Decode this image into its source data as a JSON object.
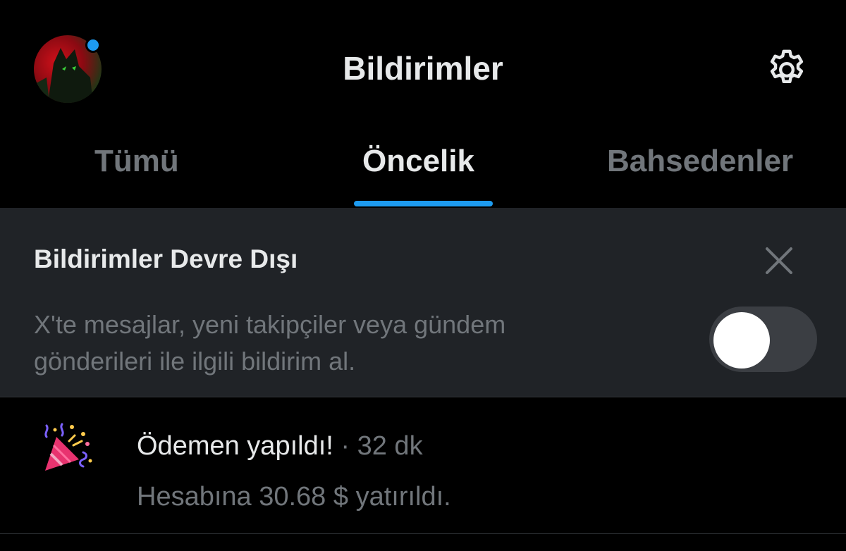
{
  "header": {
    "title": "Bildirimler",
    "avatar_icon": "wolf-avatar",
    "settings_icon": "gear-icon"
  },
  "tabs": [
    {
      "label": "Tümü",
      "active": false
    },
    {
      "label": "Öncelik",
      "active": true
    },
    {
      "label": "Bahsedenler",
      "active": false
    }
  ],
  "banner": {
    "title": "Bildirimler Devre Dışı",
    "description_line1": "X'te mesajlar, yeni takipçiler veya gündem",
    "description_line2": "gönderileri ile ilgili bildirim al.",
    "toggle_on": false,
    "close_icon": "close-icon"
  },
  "notification": {
    "icon": "party-popper-icon",
    "title": "Ödemen yapıldı!",
    "separator": "·",
    "time": "32 dk",
    "body": "Hesabına 30.68 $ yatırıldı."
  },
  "colors": {
    "background": "#000000",
    "accent": "#1d9bf0",
    "banner_bg": "#202327",
    "muted_text": "#71767b",
    "primary_text": "#e7e9ea"
  }
}
